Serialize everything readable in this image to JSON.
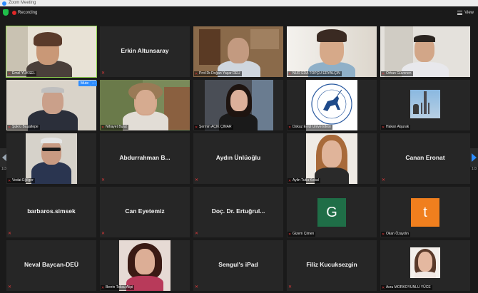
{
  "window": {
    "title": "Zoom Meeting"
  },
  "topbar": {
    "recording_label": "Recording",
    "view_label": "View"
  },
  "controls": {
    "mute_label": "Mute",
    "more_label": "..."
  },
  "pagination": {
    "left": "1/3",
    "right": "1/3"
  },
  "colors": {
    "active_speaker": "#8fd14f",
    "tile_bg": "#262626",
    "muted_mic": "#e03a3a",
    "accent": "#2d8cff"
  },
  "tiles": [
    {
      "label": "Emel YÜKSEL"
    },
    {
      "name": "Erkin Altunsaray"
    },
    {
      "label": "Prof.Dr.Doğan Yaşar DEÜ"
    },
    {
      "label": "NUR EDA TOPÇU ERYALÇIN"
    },
    {
      "label": "Orhan Güvenen"
    },
    {
      "label": "Şükrü Başaltepe"
    },
    {
      "label": "Nihayet Bulut"
    },
    {
      "label": "Şermin AÇIK ÇINAR"
    },
    {
      "label": "Dokuz Eylül Üniversitesi"
    },
    {
      "label": "Hakan Alşurak"
    },
    {
      "label": "Vedat Eğilger"
    },
    {
      "name": "Abdurrahman  B..."
    },
    {
      "name": "Aydın Ünlüoğlu"
    },
    {
      "label": "Aylin Tutlu Kokal"
    },
    {
      "name": "Canan Eronat"
    },
    {
      "name": "barbaros.simsek"
    },
    {
      "name": "Can Eyetemiz"
    },
    {
      "name": "Doç. Dr. Ertuğrul..."
    },
    {
      "avatar_letter": "G",
      "label": "Gizem Çimen"
    },
    {
      "avatar_letter": "t",
      "label": "Okan Özaydın"
    },
    {
      "name": "Neval Baycan-DEÜ"
    },
    {
      "label": "Berrin Toksu Alipi"
    },
    {
      "name": "Sengul's iPad"
    },
    {
      "name": "Filiz Kucuksezgin"
    },
    {
      "label": "Arzu MORKOYUNLU YÜCE"
    }
  ]
}
